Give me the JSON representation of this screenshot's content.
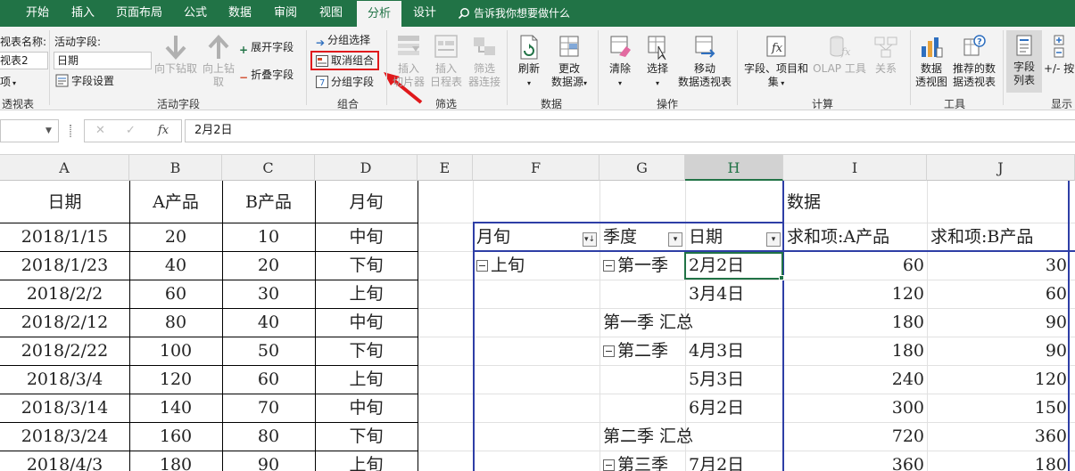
{
  "menu": {
    "tabs": [
      "开始",
      "插入",
      "页面布局",
      "公式",
      "数据",
      "审阅",
      "视图",
      "分析",
      "设计"
    ],
    "active_tab": "分析",
    "tell_me": "告诉我你想要做什么"
  },
  "ribbon": {
    "pivot": {
      "name_label": "视表名称:",
      "name_value": "视表2",
      "options_partial": "项",
      "group_label": "透视表"
    },
    "active_field": {
      "label": "活动字段:",
      "value": "日期",
      "field_settings": "字段设置",
      "drill_down": "向下钻取",
      "drill_up_1": "向上钻",
      "drill_up_2": "取",
      "expand": "展开字段",
      "collapse": "折叠字段",
      "group_label": "活动字段"
    },
    "group": {
      "group_selection": "分组选择",
      "ungroup": "取消组合",
      "group_field": "分组字段",
      "group_label": "组合"
    },
    "filter": {
      "insert_slicer_1": "插入",
      "insert_slicer_2": "切片器",
      "insert_timeline_1": "插入",
      "insert_timeline_2": "日程表",
      "filter_connections_1": "筛选",
      "filter_connections_2": "器连接",
      "group_label": "筛选"
    },
    "data": {
      "refresh": "刷新",
      "change_source_1": "更改",
      "change_source_2": "数据源",
      "group_label": "数据"
    },
    "actions": {
      "clear": "清除",
      "select": "选择",
      "move_1": "移动",
      "move_2": "数据透视表",
      "group_label": "操作"
    },
    "calculations": {
      "fields_items_1": "字段、项目和",
      "fields_items_2": "集",
      "olap": "OLAP 工具",
      "relationships": "关系",
      "group_label": "计算"
    },
    "tools": {
      "pivot_chart_1": "数据",
      "pivot_chart_2": "透视图",
      "recommended_1": "推荐的数",
      "recommended_2": "据透视表",
      "group_label": "工具"
    },
    "show": {
      "field_list_1": "字段",
      "field_list_2": "列表",
      "buttons_partial": "+/- 按",
      "group_label": "显示"
    }
  },
  "formula_bar": {
    "fx": "fx",
    "value": "2月2日"
  },
  "grid": {
    "columns": [
      "A",
      "B",
      "C",
      "D",
      "E",
      "F",
      "G",
      "H",
      "I",
      "J"
    ],
    "selected_column": "H",
    "source_headers": [
      "日期",
      "A产品",
      "B产品",
      "月旬"
    ],
    "source_rows": [
      [
        "2018/1/15",
        "20",
        "10",
        "中旬"
      ],
      [
        "2018/1/23",
        "40",
        "20",
        "下旬"
      ],
      [
        "2018/2/2",
        "60",
        "30",
        "上旬"
      ],
      [
        "2018/2/12",
        "80",
        "40",
        "中旬"
      ],
      [
        "2018/2/22",
        "100",
        "50",
        "下旬"
      ],
      [
        "2018/3/4",
        "120",
        "60",
        "上旬"
      ],
      [
        "2018/3/14",
        "140",
        "70",
        "中旬"
      ],
      [
        "2018/3/24",
        "160",
        "80",
        "下旬"
      ],
      [
        "2018/4/3",
        "180",
        "90",
        "上旬"
      ]
    ],
    "pivot": {
      "data_label": "数据",
      "headers": [
        "月旬",
        "季度",
        "日期",
        "求和项:A产品",
        "求和项:B产品"
      ],
      "rows": [
        {
          "f": "上旬",
          "g": "第一季",
          "h": "2月2日",
          "i": "60",
          "j": "30"
        },
        {
          "f": "",
          "g": "",
          "h": "3月4日",
          "i": "120",
          "j": "60"
        },
        {
          "f": "",
          "g": "第一季 汇总",
          "h": "",
          "i": "180",
          "j": "90"
        },
        {
          "f": "",
          "g": "第二季",
          "h": "4月3日",
          "i": "180",
          "j": "90"
        },
        {
          "f": "",
          "g": "",
          "h": "5月3日",
          "i": "240",
          "j": "120"
        },
        {
          "f": "",
          "g": "",
          "h": "6月2日",
          "i": "300",
          "j": "150"
        },
        {
          "f": "",
          "g": "第二季 汇总",
          "h": "",
          "i": "720",
          "j": "360"
        },
        {
          "f": "",
          "g": "第三季",
          "h": "7月2日",
          "i": "360",
          "j": "180"
        }
      ]
    }
  },
  "colors": {
    "excel_green": "#217346",
    "pivot_border_blue": "#2e3ea6",
    "highlight_red": "#e0191c"
  }
}
